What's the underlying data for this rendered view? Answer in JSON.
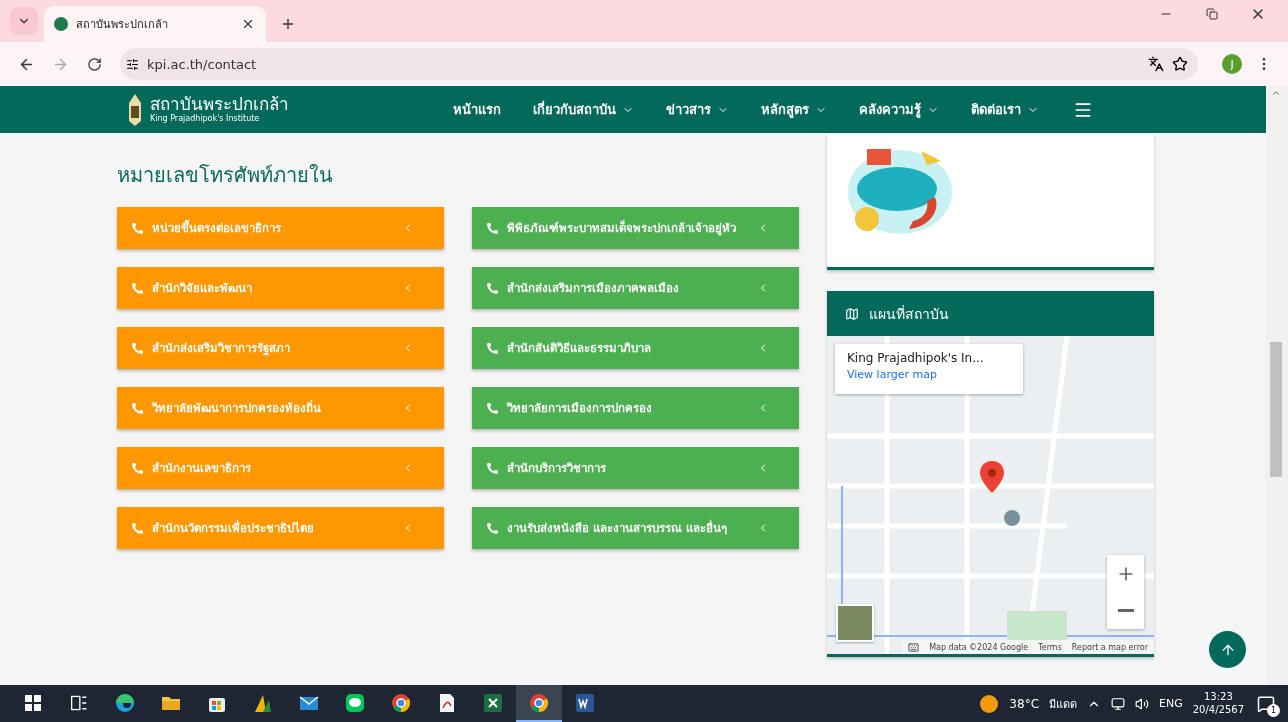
{
  "browser": {
    "tab_title": "สถาบันพระปกเกล้า",
    "url": "kpi.ac.th/contact",
    "profile_initial": "J"
  },
  "nav": {
    "brand_th": "สถาบันพระปกเกล้า",
    "brand_en": "King Prajadhipok's Institute",
    "items": [
      {
        "label": "หน้าแรก",
        "menu": false
      },
      {
        "label": "เกี่ยวกับสถาบัน",
        "menu": true
      },
      {
        "label": "ข่าวสาร",
        "menu": true
      },
      {
        "label": "หลักสูตร",
        "menu": true
      },
      {
        "label": "คลังความรู้",
        "menu": true
      },
      {
        "label": "ติดต่อเรา",
        "menu": true
      }
    ]
  },
  "section": {
    "heading": "หมายเลขโทรศัพท์ภายใน",
    "groups": [
      {
        "color": "#ff9800",
        "items": [
          "หน่วยขึ้นตรงต่อเลขาธิการ",
          "สำนักวิจัยและพัฒนา",
          "สำนักส่งเสริมวิชาการรัฐสภา",
          "วิทยาลัยพัฒนาการปกครองท้องถิ่น",
          "สำนักงานเลขาธิการ",
          "สำนักนวัตกรรมเพื่อประชาธิปไตย"
        ]
      },
      {
        "color": "#4caf50",
        "items": [
          "พิพิธภัณฑ์พระบาทสมเด็จพระปกเกล้าเจ้าอยู่หัว",
          "สำนักส่งเสริมการเมืองภาคพลเมือง",
          "สำนักสันติวิธีและธรรมาภิบาล",
          "วิทยาลัยการเมืองการปกครอง",
          "สำนักบริการวิชาการ",
          "งานรับส่งหนังสือ และงานสารบรรณ และอื่นๆ"
        ]
      }
    ]
  },
  "map_card": {
    "title": "แผนที่สถาบัน",
    "info_title": "King Prajadhipok's In...",
    "info_link": "View larger map",
    "attribution": [
      "Map data ©2024 Google",
      "Terms",
      "Report a map error"
    ]
  },
  "taskbar": {
    "apps": [
      {
        "kind": "taskview",
        "selected": false
      },
      {
        "kind": "edge",
        "selected": false
      },
      {
        "kind": "files",
        "selected": false
      },
      {
        "kind": "store",
        "selected": false
      },
      {
        "kind": "dynamics",
        "selected": false
      },
      {
        "kind": "mail",
        "selected": false
      },
      {
        "kind": "line",
        "selected": false
      },
      {
        "kind": "chrome",
        "selected": false
      },
      {
        "kind": "pdf",
        "selected": false
      },
      {
        "kind": "excel",
        "selected": false
      },
      {
        "kind": "chrome",
        "selected": true
      },
      {
        "kind": "word",
        "selected": false
      }
    ],
    "temperature": "38°C",
    "weather": "มีแดด",
    "language": "ENG",
    "time": "13:23",
    "date": "20/4/2567",
    "notifications": "1"
  }
}
